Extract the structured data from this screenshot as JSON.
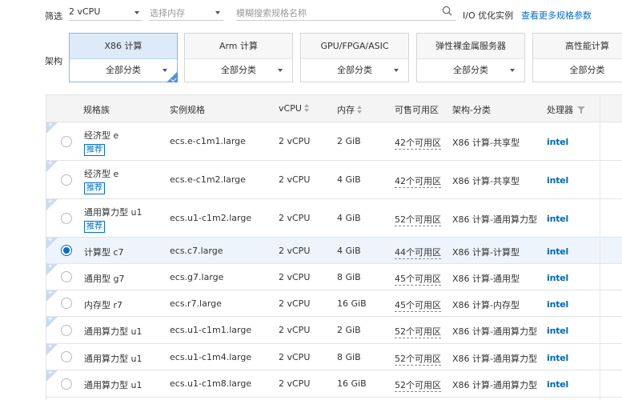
{
  "filter": {
    "label": "筛选",
    "vcpu_value": "2 vCPU",
    "memory_placeholder": "选择内存",
    "search_placeholder": "模糊搜索规格名称",
    "io_optimized": "I/O 优化实例",
    "more_link": "查看更多规格参数"
  },
  "architecture": {
    "label": "架构",
    "cards": [
      {
        "title": "X86 计算",
        "sub": "全部分类",
        "active": true
      },
      {
        "title": "Arm 计算",
        "sub": "全部分类",
        "active": false
      },
      {
        "title": "GPU/FPGA/ASIC",
        "sub": "全部分类",
        "active": false
      },
      {
        "title": "弹性裸金属服务器",
        "sub": "全部分类",
        "active": false
      },
      {
        "title": "高性能计算",
        "sub": "全部分类",
        "active": false
      }
    ]
  },
  "table": {
    "columns": {
      "family": "规格族",
      "spec": "实例规格",
      "vcpu": "vCPU",
      "memory": "内存",
      "zones": "可售可用区",
      "arch": "架构-分类",
      "processor": "处理器"
    },
    "rows": [
      {
        "family": "经济型 e",
        "badge": "推荐",
        "spec": "ecs.e-c1m1.large",
        "vcpu": "2 vCPU",
        "memory": "2 GiB",
        "zones": "42个可用区",
        "arch": "X86 计算-共享型",
        "processor": "intel",
        "selected": false
      },
      {
        "family": "经济型 e",
        "badge": "推荐",
        "spec": "ecs.e-c1m2.large",
        "vcpu": "2 vCPU",
        "memory": "4 GiB",
        "zones": "42个可用区",
        "arch": "X86 计算-共享型",
        "processor": "intel",
        "selected": false
      },
      {
        "family": "通用算力型 u1",
        "badge": "推荐",
        "spec": "ecs.u1-c1m2.large",
        "vcpu": "2 vCPU",
        "memory": "4 GiB",
        "zones": "52个可用区",
        "arch": "X86 计算-通用算力型",
        "processor": "intel",
        "selected": false
      },
      {
        "family": "计算型 c7",
        "badge": "",
        "spec": "ecs.c7.large",
        "vcpu": "2 vCPU",
        "memory": "4 GiB",
        "zones": "44个可用区",
        "arch": "X86 计算-计算型",
        "processor": "intel",
        "selected": true
      },
      {
        "family": "通用型 g7",
        "badge": "",
        "spec": "ecs.g7.large",
        "vcpu": "2 vCPU",
        "memory": "8 GiB",
        "zones": "45个可用区",
        "arch": "X86 计算-通用型",
        "processor": "intel",
        "selected": false
      },
      {
        "family": "内存型 r7",
        "badge": "",
        "spec": "ecs.r7.large",
        "vcpu": "2 vCPU",
        "memory": "16 GiB",
        "zones": "45个可用区",
        "arch": "X86 计算-内存型",
        "processor": "intel",
        "selected": false
      },
      {
        "family": "通用算力型 u1",
        "badge": "",
        "spec": "ecs.u1-c1m1.large",
        "vcpu": "2 vCPU",
        "memory": "2 GiB",
        "zones": "52个可用区",
        "arch": "X86 计算-通用算力型",
        "processor": "intel",
        "selected": false
      },
      {
        "family": "通用算力型 u1",
        "badge": "",
        "spec": "ecs.u1-c1m4.large",
        "vcpu": "2 vCPU",
        "memory": "8 GiB",
        "zones": "52个可用区",
        "arch": "X86 计算-通用算力型",
        "processor": "intel",
        "selected": false
      },
      {
        "family": "通用算力型 u1",
        "badge": "",
        "spec": "ecs.u1-c1m8.large",
        "vcpu": "2 vCPU",
        "memory": "16 GiB",
        "zones": "52个可用区",
        "arch": "X86 计算-通用算力型",
        "processor": "intel",
        "selected": false
      }
    ]
  },
  "colors": {
    "accent": "#0070cc",
    "active_card_bg": "#ddeaf8",
    "selected_row_bg": "#eef4fb",
    "intel_blue": "#0068b5"
  }
}
